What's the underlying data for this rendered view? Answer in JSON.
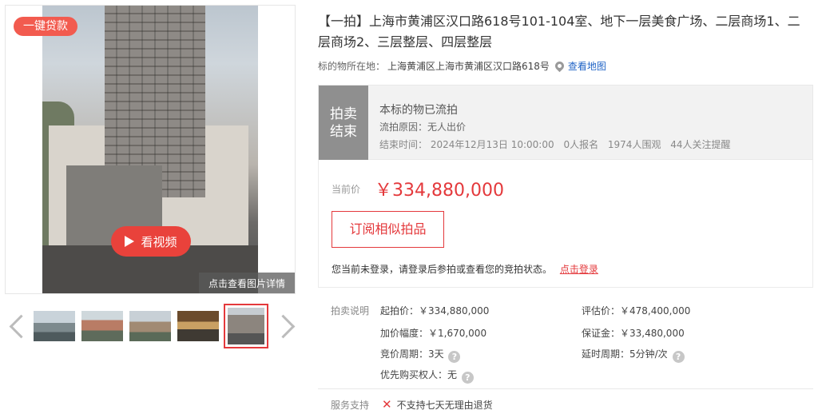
{
  "gallery": {
    "loan_badge": "一键贷款",
    "video_label": "看视频",
    "detail_label": "点击查看图片详情"
  },
  "item": {
    "title": "【一拍】上海市黄浦区汉口路618号101-104室、地下一层美食广场、二层商场1、二层商场2、三层整层、四层整层",
    "location_label": "标的物所在地：",
    "location": "上海黄浦区上海市黄浦区汉口路618号",
    "map_link": "查看地图"
  },
  "status": {
    "tag": "拍卖结束",
    "main": "本标的物已流拍",
    "reason": "流拍原因：无人出价",
    "end_time": "结束时间：  2024年12月13日 10:00:00",
    "signups": "0人报名",
    "viewers": "1974人围观",
    "watchers": "44人关注提醒"
  },
  "price": {
    "label": "当前价",
    "value": "￥334,880,000",
    "subscribe": "订阅相似拍品",
    "login_tip": "您当前未登录，请登录后参拍或查看您的竞拍状态。",
    "login_link": "点击登录"
  },
  "params": {
    "section_label": "拍卖说明",
    "start_price": "起拍价：￥334,880,000",
    "appraisal": "评估价：￥478,400,000",
    "increment": "加价幅度：￥1,670,000",
    "deposit": "保证金：￥33,480,000",
    "bid_period": "竞价周期：3天",
    "delay_period": "延时周期：5分钟/次",
    "priority_buyer": "优先购买权人：无"
  },
  "service": {
    "label": "服务支持",
    "text": "不支持七天无理由退货"
  },
  "icons": {
    "pin": "location-pin-icon",
    "help": "question-circle-icon",
    "x": "cross-icon",
    "play": "play-icon"
  },
  "colors": {
    "accent": "#e4393c",
    "status_tag": "#8f8f8f",
    "link": "#1f63c6"
  }
}
